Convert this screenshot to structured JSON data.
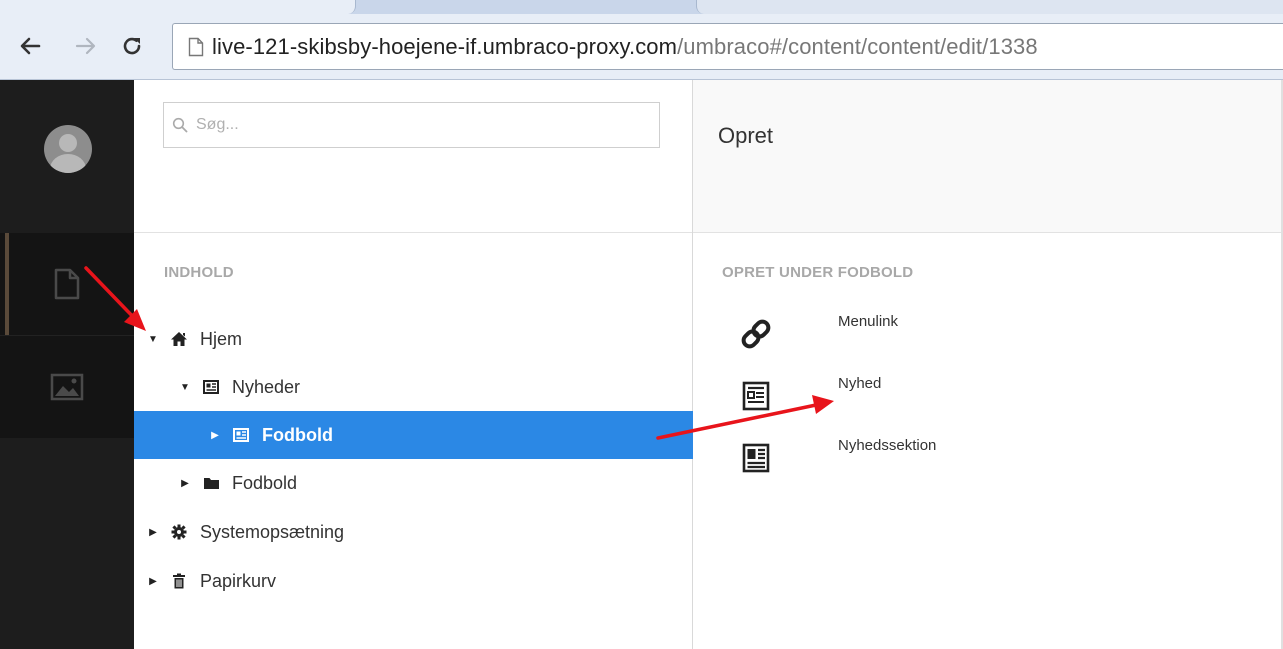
{
  "browser": {
    "url_host": "live-121-skibsby-hoejene-if.umbraco-proxy.com",
    "url_path": "/umbraco#/content/content/edit/1338",
    "back_icon": "arrow-left-icon",
    "forward_icon": "arrow-right-icon",
    "reload_icon": "reload-icon",
    "page_icon": "document-icon"
  },
  "sidebar": {
    "avatar_icon": "user-avatar-icon",
    "sections": [
      {
        "name": "content",
        "icon": "document-icon",
        "active": true
      },
      {
        "name": "media",
        "icon": "image-icon",
        "active": false
      }
    ]
  },
  "tree": {
    "search_placeholder": "Søg...",
    "section_title": "INDHOLD",
    "nodes": [
      {
        "label": "Hjem",
        "icon": "home-icon",
        "expanded": true,
        "level": 0
      },
      {
        "label": "Nyheder",
        "icon": "newspaper-icon",
        "expanded": true,
        "level": 1
      },
      {
        "label": "Fodbold",
        "icon": "newspaper-icon",
        "expanded": false,
        "level": 2,
        "selected": true
      },
      {
        "label": "Fodbold",
        "icon": "folder-icon",
        "expanded": false,
        "level": 1
      },
      {
        "label": "Systemopsætning",
        "icon": "gear-icon",
        "expanded": false,
        "level": 0
      },
      {
        "label": "Papirkurv",
        "icon": "trash-icon",
        "expanded": false,
        "level": 0
      }
    ],
    "more_label": "•••"
  },
  "editor": {
    "title": "Opret",
    "create_under_title": "OPRET UNDER FODBOLD",
    "types": [
      {
        "label": "Menulink",
        "icon": "link-icon"
      },
      {
        "label": "Nyhed",
        "icon": "news-document-icon"
      },
      {
        "label": "Nyhedssektion",
        "icon": "newspaper-icon"
      }
    ]
  },
  "colors": {
    "selected": "#2b88e5",
    "sidebar": "#1d1d1d",
    "annotation_arrow": "#e8141b"
  }
}
